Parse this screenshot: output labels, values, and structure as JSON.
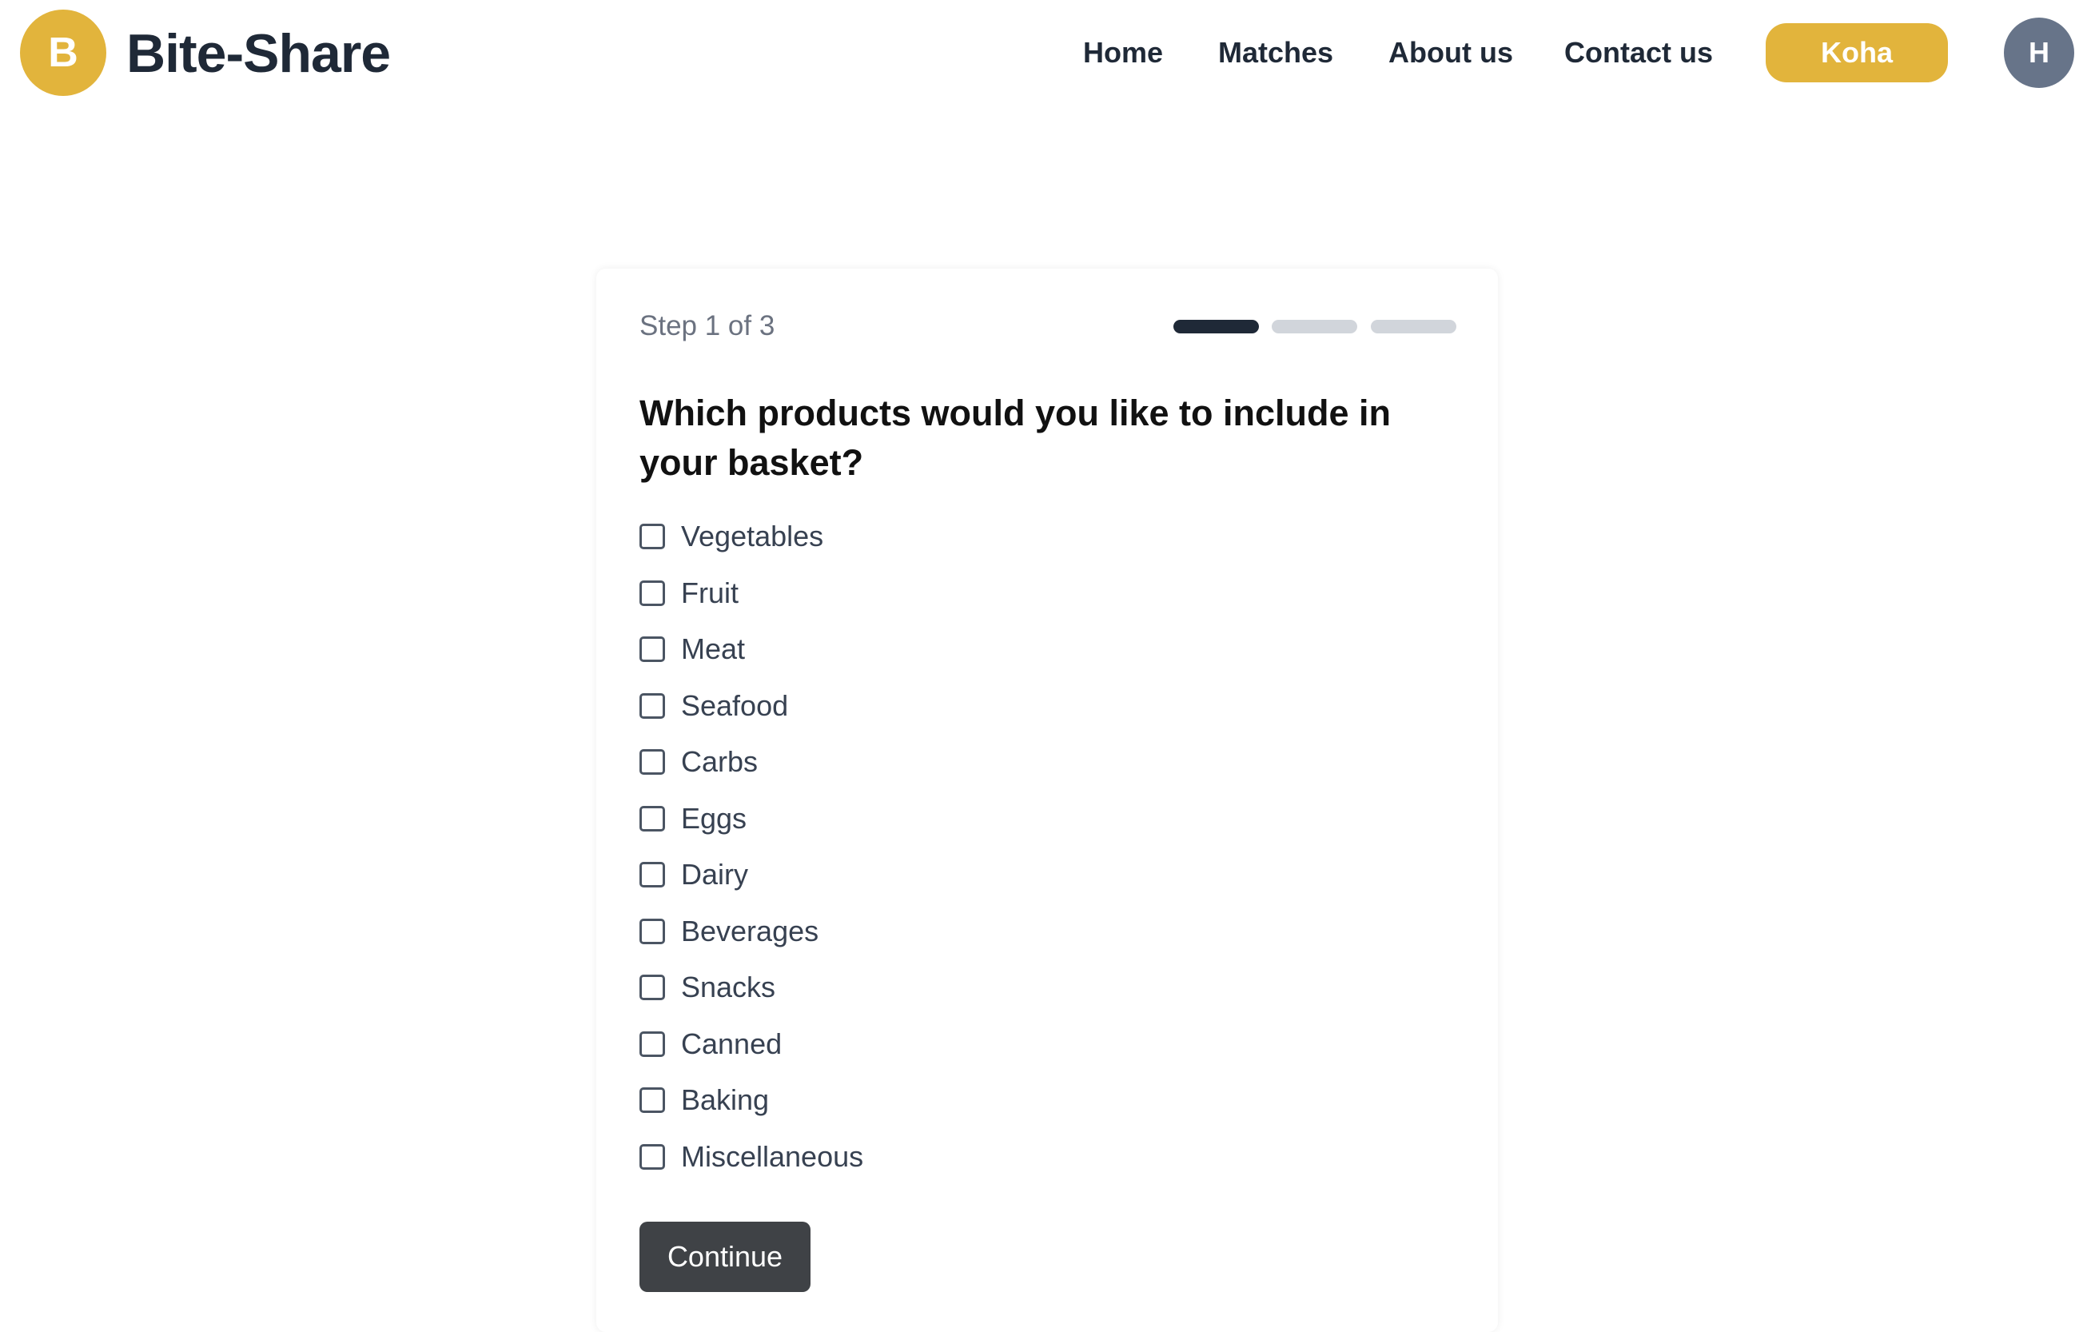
{
  "header": {
    "logo_letter": "B",
    "brand": "Bite-Share",
    "nav": {
      "home": "Home",
      "matches": "Matches",
      "about": "About us",
      "contact": "Contact us"
    },
    "cta_label": "Koha",
    "avatar_initial": "H"
  },
  "wizard": {
    "step_label": "Step 1 of 3",
    "current_step": 1,
    "total_steps": 3,
    "question": "Which products would you like to include in your basket?",
    "options": [
      {
        "label": "Vegetables",
        "checked": false
      },
      {
        "label": "Fruit",
        "checked": false
      },
      {
        "label": "Meat",
        "checked": false
      },
      {
        "label": "Seafood",
        "checked": false
      },
      {
        "label": "Carbs",
        "checked": false
      },
      {
        "label": "Eggs",
        "checked": false
      },
      {
        "label": "Dairy",
        "checked": false
      },
      {
        "label": "Beverages",
        "checked": false
      },
      {
        "label": "Snacks",
        "checked": false
      },
      {
        "label": "Canned",
        "checked": false
      },
      {
        "label": "Baking",
        "checked": false
      },
      {
        "label": "Miscellaneous",
        "checked": false
      }
    ],
    "continue_label": "Continue"
  },
  "colors": {
    "accent": "#e2b43c",
    "text_dark": "#1f2937",
    "avatar_bg": "#677489",
    "progress_active": "#1f2937",
    "progress_inactive": "#d1d5db",
    "button_dark": "#3f4246"
  }
}
